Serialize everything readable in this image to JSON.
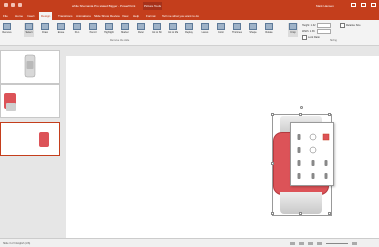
{
  "titlebar": {
    "title": "while Shemanta Pro stated Bigger - PowerPoint",
    "context_tab": "Picture Tools",
    "user": "Mark Hansen"
  },
  "tabs": [
    {
      "label": "File"
    },
    {
      "label": "Home"
    },
    {
      "label": "Insert"
    },
    {
      "label": "Design"
    },
    {
      "label": "Transitions"
    },
    {
      "label": "Animations"
    },
    {
      "label": "Slide Show"
    },
    {
      "label": "Review"
    },
    {
      "label": "View"
    },
    {
      "label": "Help"
    },
    {
      "label": "Format"
    },
    {
      "label": "Tell me what you want to do"
    }
  ],
  "ribbon": {
    "buttons": [
      "Remove",
      "Select",
      "Draw",
      "Erase",
      "Pen",
      "Pencil",
      "Highlight",
      "Marker",
      "Ruler",
      "Ink to Shape",
      "Ink to Math",
      "Replay",
      "Lasso",
      "Color",
      "Thickness",
      "Shape",
      "Rotate",
      "Crop",
      "Position",
      "Wrap",
      "Align"
    ],
    "group_label": "Remove the slide",
    "size_label": "Sizing",
    "fields": {
      "height_label": "Height: 1.32",
      "width_label": "Width: 1.36",
      "lock_label": "Lock Ratio",
      "relative_label": "Relative Size"
    }
  },
  "status": {
    "left": "Slide 3 of 3   English (US)"
  },
  "colors": {
    "accent": "#c43e1c",
    "watch_face": "#dc5358"
  }
}
